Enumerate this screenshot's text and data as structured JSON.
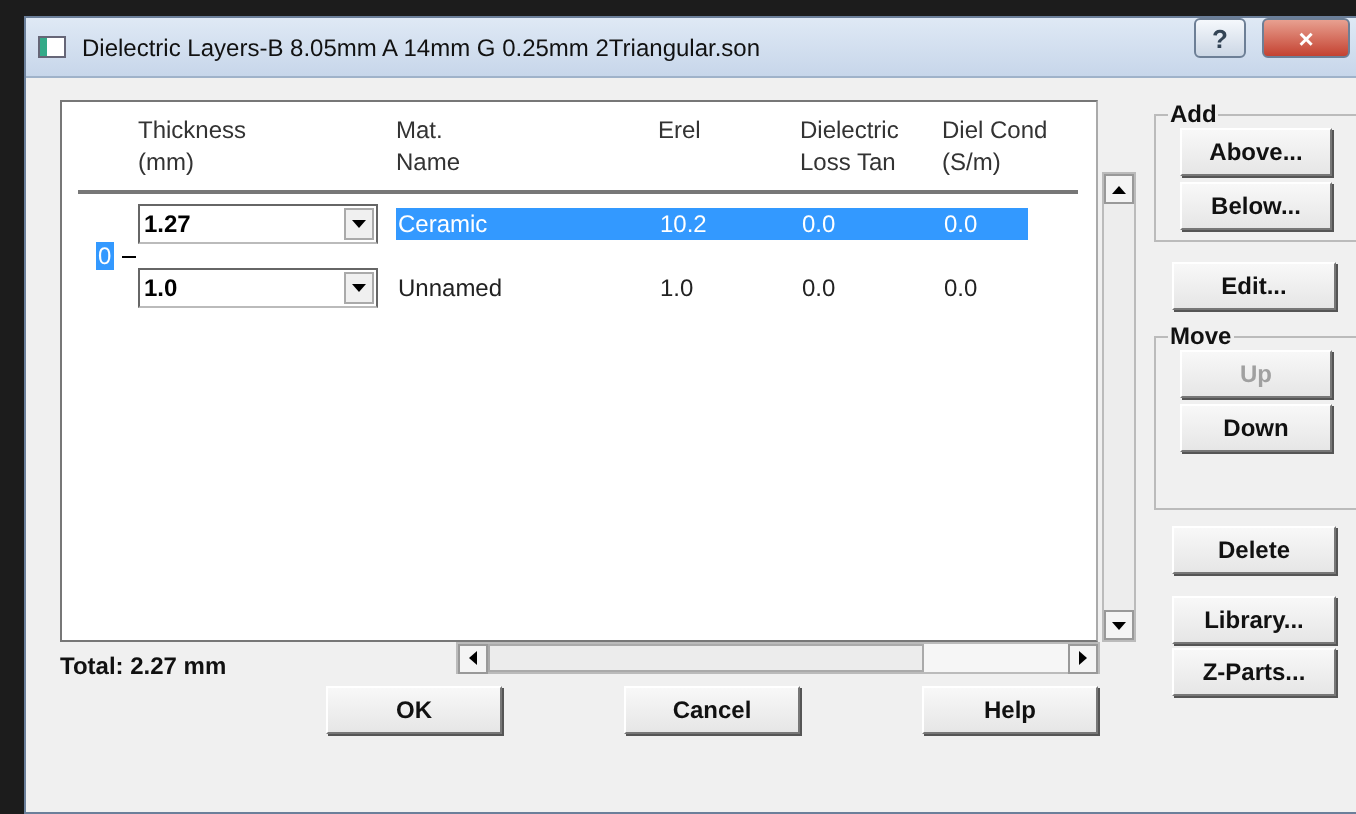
{
  "window": {
    "title": "Dielectric Layers-B 8.05mm A 14mm G 0.25mm 2Triangular.son",
    "help": "?",
    "close": "×"
  },
  "columns": [
    {
      "line1": "Thickness",
      "line2": "(mm)"
    },
    {
      "line1": "Mat.",
      "line2": "Name"
    },
    {
      "line1": "Erel"
    },
    {
      "line1": "Dielectric",
      "line2": "Loss Tan"
    },
    {
      "line1": "Diel Cond",
      "line2": "(S/m)"
    }
  ],
  "layer_label": {
    "text": "0",
    "selected": true
  },
  "rows": [
    {
      "thickness": "1.27",
      "name": "Ceramic",
      "erel": "10.2",
      "loss_tan": "0.0",
      "diel_cond": "0.0",
      "selected": true
    },
    {
      "thickness": "1.0",
      "name": "Unnamed",
      "erel": "1.0",
      "loss_tan": "0.0",
      "diel_cond": "0.0",
      "selected": false
    }
  ],
  "total": "Total: 2.27 mm",
  "add_group": {
    "label": "Add",
    "buttons": [
      {
        "label": "Above...",
        "disabled": false
      },
      {
        "label": "Below...",
        "disabled": false
      }
    ]
  },
  "edit_button": "Edit...",
  "move_group": {
    "label": "Move",
    "buttons": [
      {
        "label": "Up",
        "disabled": true
      },
      {
        "label": "Down",
        "disabled": false
      }
    ]
  },
  "side_buttons": [
    "Delete",
    "Library...",
    "Z-Parts..."
  ],
  "dialog_buttons": [
    "OK",
    "Cancel",
    "Help"
  ]
}
